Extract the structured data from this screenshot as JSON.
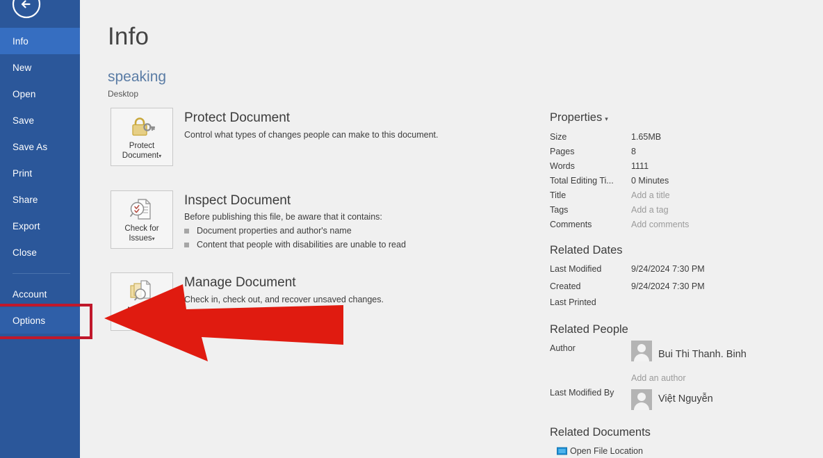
{
  "sidebar": {
    "back_icon": "back-arrow-icon",
    "items": [
      {
        "label": "Info",
        "state": "active"
      },
      {
        "label": "New",
        "state": "normal"
      },
      {
        "label": "Open",
        "state": "normal"
      },
      {
        "label": "Save",
        "state": "normal"
      },
      {
        "label": "Save As",
        "state": "normal"
      },
      {
        "label": "Print",
        "state": "normal"
      },
      {
        "label": "Share",
        "state": "normal"
      },
      {
        "label": "Export",
        "state": "normal"
      },
      {
        "label": "Close",
        "state": "normal"
      },
      {
        "label": "Account",
        "state": "normal"
      },
      {
        "label": "Options",
        "state": "selected"
      }
    ]
  },
  "main": {
    "page_title": "Info",
    "document_name": "speaking",
    "document_path": "Desktop",
    "blocks": [
      {
        "button_label_line1": "Protect",
        "button_label_line2": "Document",
        "button_caret": "▾",
        "icon": "padlock-key-icon",
        "title": "Protect Document",
        "description": "Control what types of changes people can make to this document."
      },
      {
        "button_label_line1": "Check for",
        "button_label_line2": "Issues",
        "button_caret": "▾",
        "icon": "document-magnifier-icon",
        "title": "Inspect Document",
        "description": "Before publishing this file, be aware that it contains:",
        "bullets": [
          "Document properties and author's name",
          "Content that people with disabilities are unable to read"
        ]
      },
      {
        "button_label_line1": "Manage",
        "button_label_line2": "Document",
        "button_caret": "▾",
        "icon": "documents-stack-magnifier-icon",
        "title": "Manage Document",
        "description": "Check in, check out, and recover unsaved changes."
      }
    ]
  },
  "properties": {
    "heading": "Properties",
    "caret": "▾",
    "rows": [
      {
        "label": "Size",
        "value": "1.65MB",
        "muted": false
      },
      {
        "label": "Pages",
        "value": "8",
        "muted": false
      },
      {
        "label": "Words",
        "value": "1111",
        "muted": false
      },
      {
        "label": "Total Editing Ti...",
        "value": "0 Minutes",
        "muted": false
      },
      {
        "label": "Title",
        "value": "Add a title",
        "muted": true
      },
      {
        "label": "Tags",
        "value": "Add a tag",
        "muted": true
      },
      {
        "label": "Comments",
        "value": "Add comments",
        "muted": true
      }
    ]
  },
  "related_dates": {
    "heading": "Related Dates",
    "rows": [
      {
        "label": "Last Modified",
        "value": "9/24/2024 7:30 PM"
      },
      {
        "label": "Created",
        "value": "9/24/2024 7:30 PM"
      },
      {
        "label": "Last Printed",
        "value": ""
      }
    ]
  },
  "related_people": {
    "heading": "Related People",
    "author_label": "Author",
    "author_name": "Bui Thi Thanh. Binh",
    "add_author": "Add an author",
    "last_modified_by_label": "Last Modified By",
    "last_modified_by_name": "Việt Nguyễn"
  },
  "related_documents": {
    "heading": "Related Documents",
    "open_file_location": "Open File Location",
    "folder_icon": "folder-open-icon"
  },
  "annotations": {
    "arrow": {
      "name": "red-pointer-arrow",
      "color": "#e01b10"
    },
    "highlight_box": {
      "name": "options-highlight-box",
      "color": "#c0182b"
    }
  },
  "colors": {
    "sidebar_bg": "#2b579a",
    "sidebar_active": "#366ec1",
    "accent_doc_title": "#5a7ca5",
    "page_bg": "#f0f0f0"
  }
}
